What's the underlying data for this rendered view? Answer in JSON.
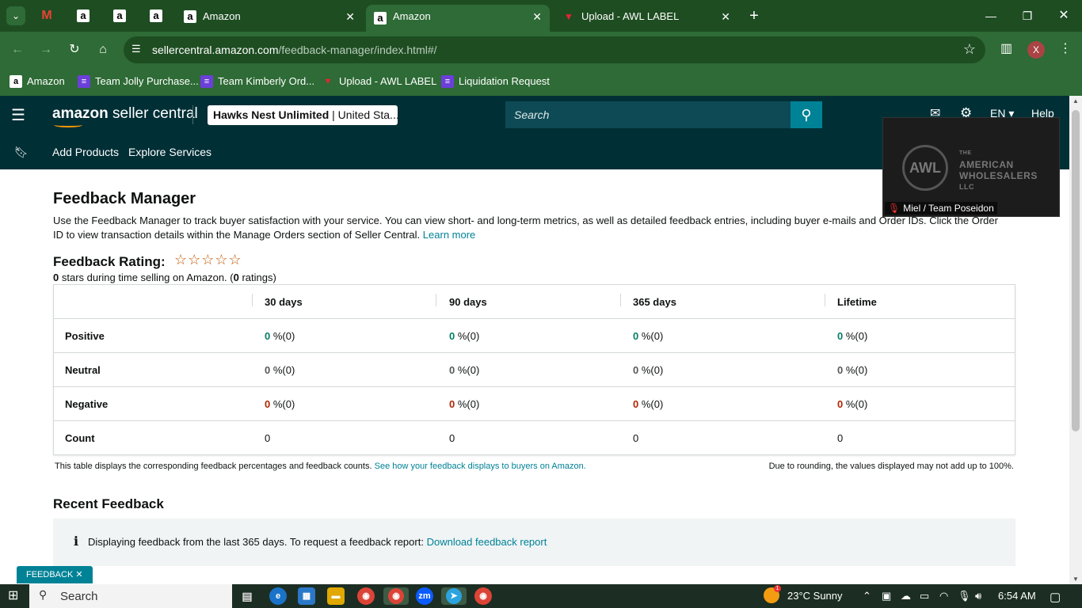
{
  "browser": {
    "tabs": [
      {
        "title": "Amazon",
        "active": false
      },
      {
        "title": "Amazon",
        "active": true
      },
      {
        "title": "Upload - AWL LABEL",
        "active": false
      }
    ],
    "url_host": "sellercentral.amazon.com",
    "url_path": "/feedback-manager/index.html#/",
    "profile_initial": "X",
    "bookmarks": [
      {
        "label": "Amazon",
        "icon": "amazon"
      },
      {
        "label": "Team Jolly Purchase...",
        "icon": "list"
      },
      {
        "label": "Team Kimberly Ord...",
        "icon": "list"
      },
      {
        "label": "Upload - AWL LABEL",
        "icon": "awl"
      },
      {
        "label": "Liquidation Request",
        "icon": "list"
      }
    ]
  },
  "header": {
    "logo_brand": "amazon",
    "logo_suffix": "seller central",
    "account_name": "Hawks Nest Unlimited",
    "account_region": "| United Sta...",
    "search_placeholder": "Search",
    "language": "EN",
    "help": "Help"
  },
  "subnav": {
    "links": [
      "Add Products",
      "Explore Services"
    ]
  },
  "video_overlay": {
    "brand_line1": "THE",
    "brand_line2": "AMERICAN",
    "brand_line3": "WHOLESALERS",
    "brand_line4": "LLC",
    "logo_text": "AWL",
    "participant": "Miel / Team Poseidon"
  },
  "page": {
    "title": "Feedback Manager",
    "intro": "Use the Feedback Manager to track buyer satisfaction with your service. You can view short- and long-term metrics, as well as detailed feedback entries, including buyer e-mails and Order IDs. Click the Order ID to view transaction details within the Manage Orders section of Seller Central.",
    "learn_more": "Learn more",
    "rating_title": "Feedback Rating:",
    "rating_stars": "☆☆☆☆☆",
    "rating_count_stars": "0",
    "rating_sub_mid": " stars during time selling on Amazon. (",
    "rating_count_ratings": "0",
    "rating_sub_end": " ratings)"
  },
  "table": {
    "columns": [
      "30 days",
      "90 days",
      "365 days",
      "Lifetime"
    ],
    "rows": {
      "positive": {
        "label": "Positive",
        "values": [
          "0",
          "0",
          "0",
          "0"
        ],
        "suffix": "%(0)"
      },
      "neutral": {
        "label": "Neutral",
        "values": [
          "0",
          "0",
          "0",
          "0"
        ],
        "suffix": "%(0)"
      },
      "negative": {
        "label": "Negative",
        "values": [
          "0",
          "0",
          "0",
          "0"
        ],
        "suffix": "%(0)"
      },
      "count": {
        "label": "Count",
        "values": [
          "0",
          "0",
          "0",
          "0"
        ]
      }
    },
    "footnote": "This table displays the corresponding feedback percentages and feedback counts.",
    "footnote_link": "See how your feedback displays to buyers on Amazon.",
    "rounding_note": "Due to rounding, the values displayed may not add up to 100%."
  },
  "recent": {
    "title": "Recent Feedback",
    "info": "Displaying feedback from the last 365 days. To request a feedback report:",
    "info_link": "Download feedback report"
  },
  "feedback_tab": "FEEDBACK ✕",
  "taskbar": {
    "search": "Search",
    "weather": "23°C  Sunny",
    "time": "6:54 AM"
  }
}
